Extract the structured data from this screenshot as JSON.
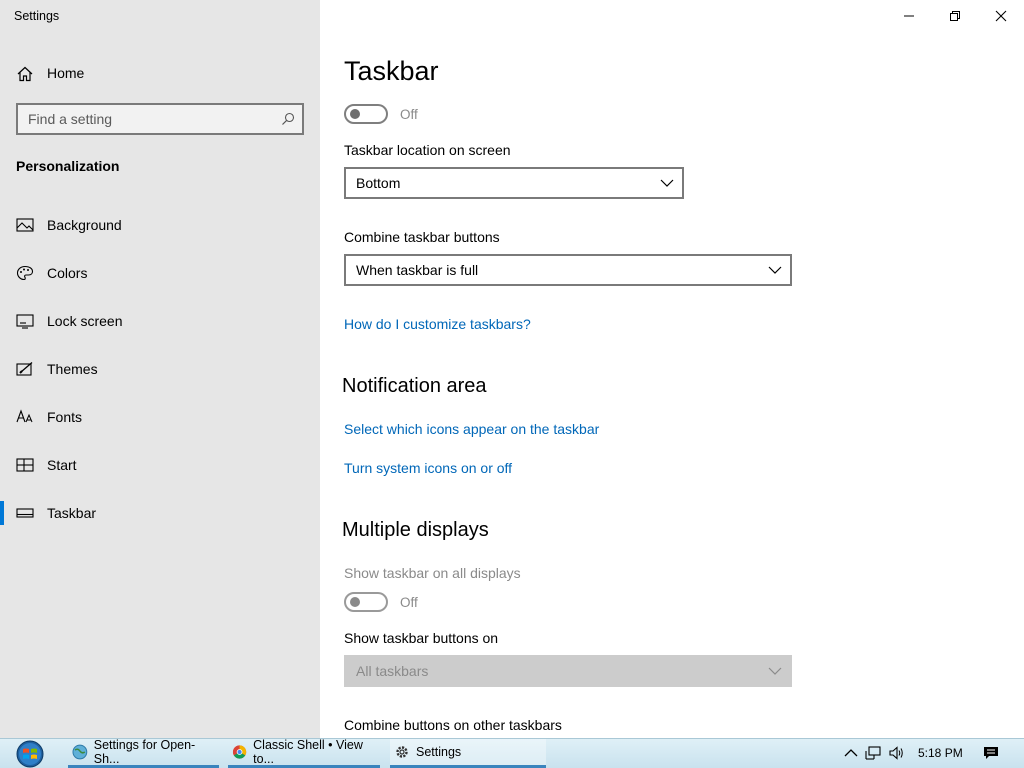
{
  "window": {
    "title": "Settings"
  },
  "sidebar": {
    "home_label": "Home",
    "search_placeholder": "Find a setting",
    "section_title": "Personalization",
    "items": [
      {
        "label": "Background",
        "icon": "picture-icon"
      },
      {
        "label": "Colors",
        "icon": "palette-icon"
      },
      {
        "label": "Lock screen",
        "icon": "lock-screen-icon"
      },
      {
        "label": "Themes",
        "icon": "themes-icon"
      },
      {
        "label": "Fonts",
        "icon": "fonts-icon"
      },
      {
        "label": "Start",
        "icon": "start-icon"
      },
      {
        "label": "Taskbar",
        "icon": "taskbar-icon",
        "selected": true
      }
    ]
  },
  "main": {
    "title": "Taskbar",
    "toggle1_state": "Off",
    "location_label": "Taskbar location on screen",
    "location_value": "Bottom",
    "combine_label": "Combine taskbar buttons",
    "combine_value": "When taskbar is full",
    "customize_link": "How do I customize taskbars?",
    "notification_heading": "Notification area",
    "select_icons_link": "Select which icons appear on the taskbar",
    "system_icons_link": "Turn system icons on or off",
    "multiple_heading": "Multiple displays",
    "show_all_label": "Show taskbar on all displays",
    "toggle2_state": "Off",
    "show_buttons_label": "Show taskbar buttons on",
    "show_buttons_value": "All taskbars",
    "combine_other_label": "Combine buttons on other taskbars"
  },
  "taskbar": {
    "buttons": [
      {
        "label": "Settings for Open-Sh...",
        "icon": "globe-icon"
      },
      {
        "label": "Classic Shell • View to...",
        "icon": "chrome-icon"
      },
      {
        "label": "Settings",
        "icon": "gear-icon"
      }
    ],
    "clock": "5:18 PM"
  },
  "colors": {
    "accent": "#0078d7",
    "link": "#0067b8",
    "sidebar_bg": "#e6e6e6"
  }
}
